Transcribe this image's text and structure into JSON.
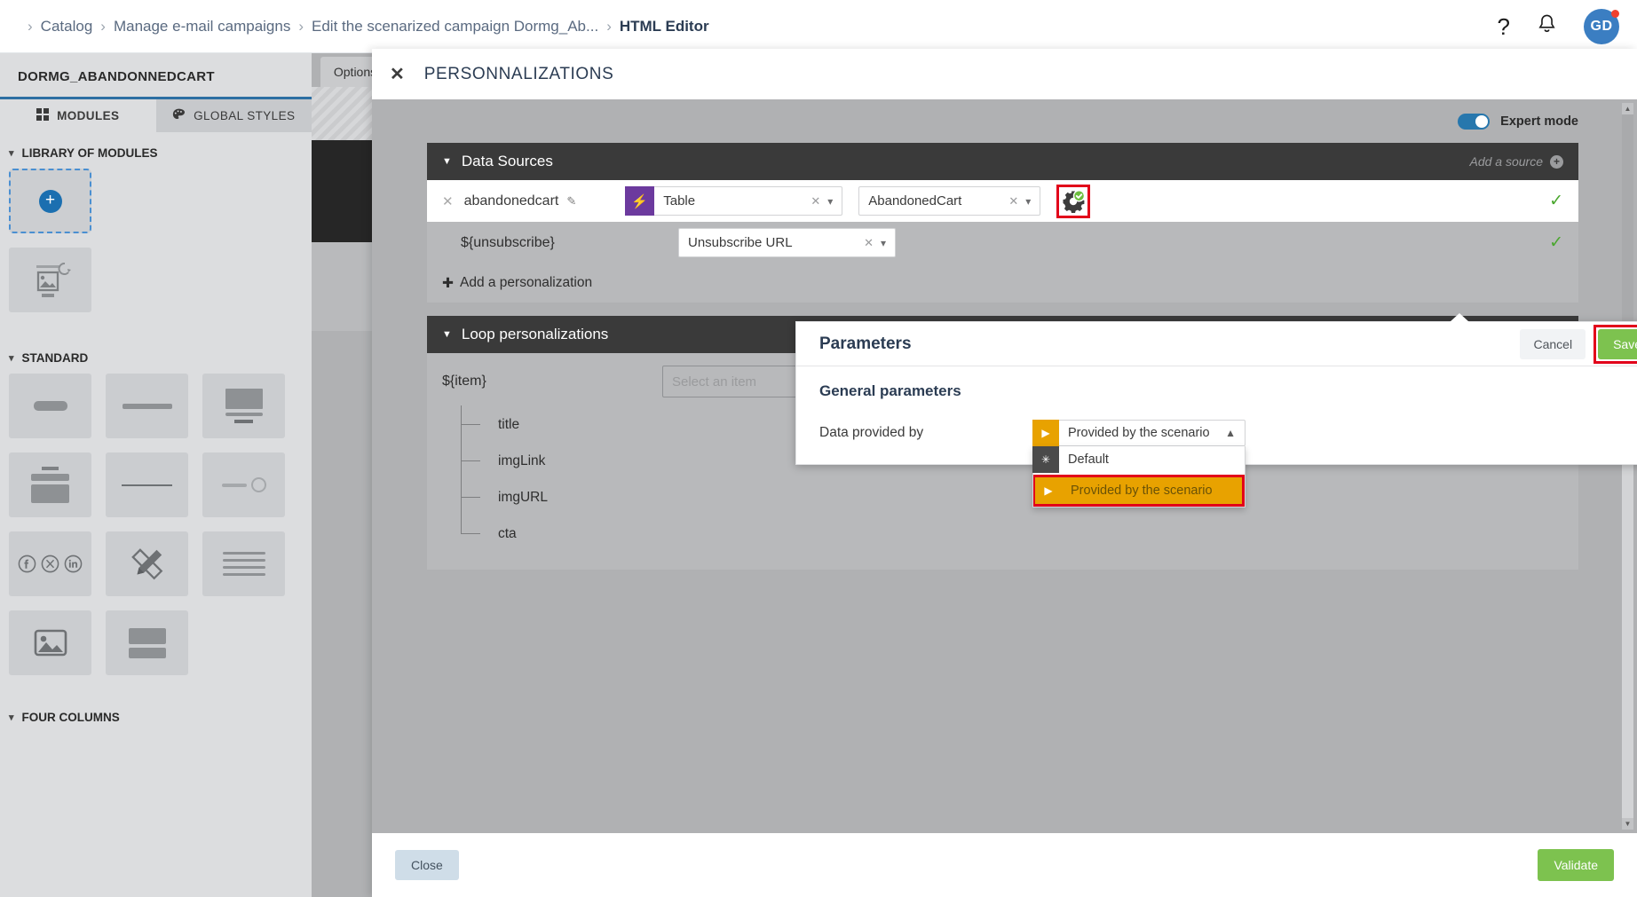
{
  "topbar": {
    "breadcrumb": [
      {
        "label": "Catalog"
      },
      {
        "label": "Manage e-mail campaigns"
      },
      {
        "label": "Edit the scenarized campaign Dormg_Ab..."
      },
      {
        "label": "HTML Editor"
      }
    ],
    "help_icon": "question-mark-icon",
    "bell_icon": "bell-icon",
    "avatar_initials": "GD"
  },
  "sidebar": {
    "title": "DORMG_ABANDONNEDCART",
    "tabs": [
      {
        "label": "MODULES",
        "icon": "grid-icon",
        "active": true
      },
      {
        "label": "GLOBAL STYLES",
        "icon": "palette-icon",
        "active": false
      }
    ],
    "sections": [
      {
        "label": "LIBRARY OF MODULES"
      },
      {
        "label": "STANDARD"
      },
      {
        "label": "FOUR COLUMNS"
      }
    ]
  },
  "canvas": {
    "options_tab": "Options"
  },
  "modal": {
    "title": "PERSONNALIZATIONS",
    "close_icon": "close-icon",
    "expert_mode": {
      "label": "Expert mode",
      "enabled": true
    },
    "footer": {
      "close_label": "Close",
      "validate_label": "Validate"
    }
  },
  "data_sources": {
    "header": "Data Sources",
    "add_source_label": "Add a source",
    "row": {
      "name": "abandonedcart",
      "type_value": "Table",
      "type_icon": "lightning-icon",
      "table_value": "AbandonedCart",
      "gear_icon": "gear-check-icon",
      "status_icon": "check-icon"
    }
  },
  "parameters": {
    "title": "Parameters",
    "cancel_label": "Cancel",
    "save_label": "Save",
    "subtitle": "General parameters",
    "data_provided_by": {
      "label": "Data provided by",
      "selected": "Provided by the scenario",
      "selected_icon": "play-icon",
      "options": [
        {
          "label": "Default",
          "icon": "asterisk-icon",
          "highlighted": false
        },
        {
          "label": "Provided by the scenario",
          "icon": "play-icon",
          "highlighted": true
        }
      ]
    }
  },
  "personalizations": {
    "rows": [
      {
        "key": "${unsubscribe}",
        "value": "Unsubscribe URL",
        "status": "check-icon"
      }
    ],
    "add_label": "Add a personalization"
  },
  "loop_personalizations": {
    "header": "Loop personalizations",
    "key": "${item}",
    "select_placeholder": "Select an item",
    "tree_items": [
      {
        "label": "title"
      },
      {
        "label": "imgLink"
      },
      {
        "label": "imgURL"
      },
      {
        "label": "cta"
      }
    ]
  },
  "colors": {
    "accent_blue": "#2777ad",
    "save_green": "#7dc24f",
    "highlight_red": "#e2001a",
    "dropdown_orange": "#e8a200",
    "panel_dark": "#3a3a3a",
    "purple_badge": "#6c3a9e"
  }
}
